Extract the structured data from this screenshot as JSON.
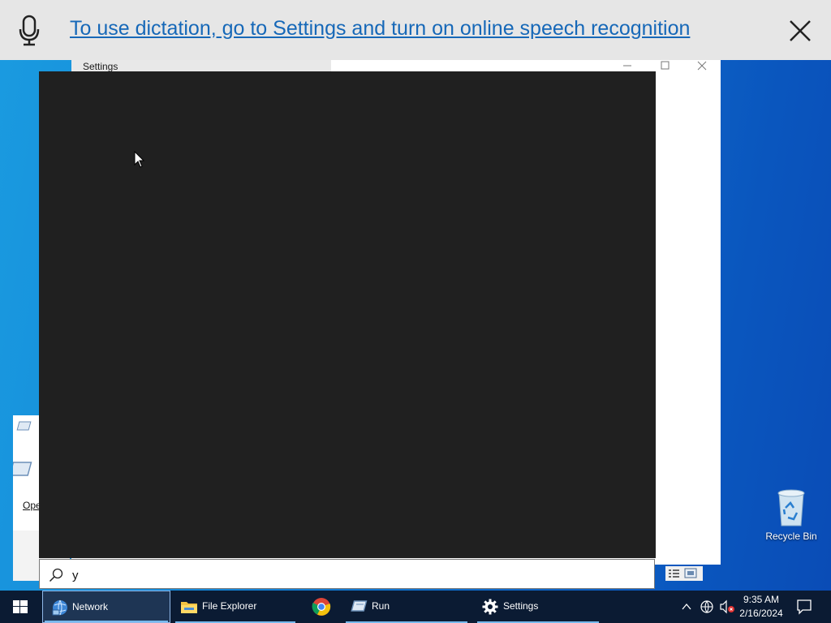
{
  "dictation": {
    "message": "To use dictation, go to Settings and turn on online speech recognition",
    "mic_icon": "microphone-icon",
    "close_icon": "close-icon"
  },
  "settings_window": {
    "title": "Settings"
  },
  "run_dialog": {
    "open_label": "Ope"
  },
  "search": {
    "query": "y",
    "icon": "search-icon"
  },
  "desktop": {
    "recycle_bin_label": "Recycle Bin"
  },
  "taskbar": {
    "items": [
      {
        "label": "Network",
        "icon": "network-globe-icon",
        "active": true
      },
      {
        "label": "File Explorer",
        "icon": "folder-icon",
        "active": false
      },
      {
        "label": "",
        "icon": "chrome-icon",
        "active": false
      },
      {
        "label": "Run",
        "icon": "run-icon",
        "active": false
      },
      {
        "label": "Settings",
        "icon": "gear-icon",
        "active": false
      }
    ],
    "clock": {
      "time": "9:35 AM",
      "date": "2/16/2024"
    }
  },
  "colors": {
    "dictation_link": "#1668b8",
    "search_panel_bg": "#202020",
    "taskbar_bg": "#0b1b33",
    "taskbar_accent": "#76b9ed"
  }
}
